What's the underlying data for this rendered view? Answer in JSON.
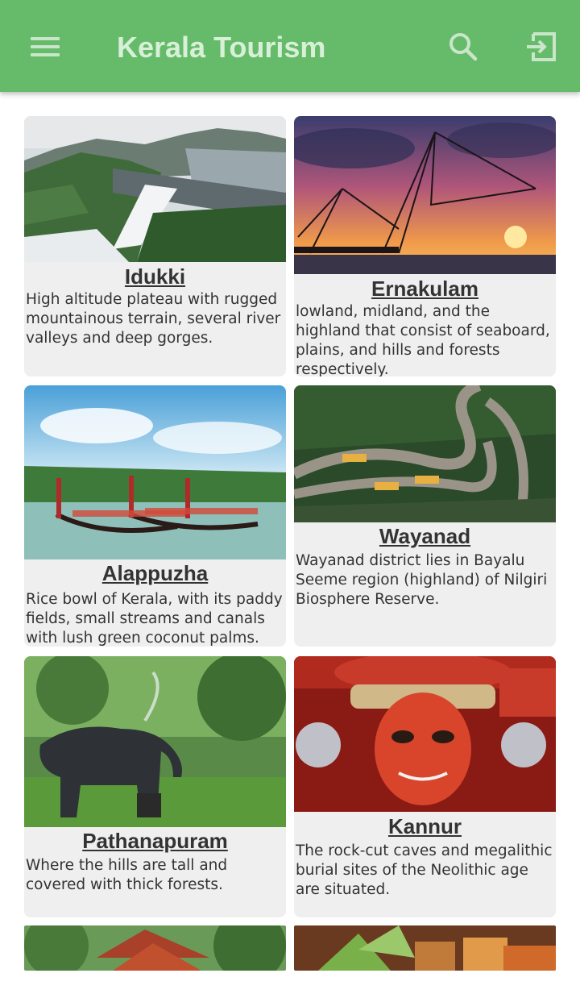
{
  "app_bar": {
    "title": "Kerala Tourism",
    "icons": [
      "menu-icon",
      "search-icon",
      "logout-icon"
    ],
    "color": "#66bb6a"
  },
  "places": [
    {
      "name": "Idukki",
      "description": "High altitude plateau with rugged mountainous terrain, several river valleys and deep gorges.",
      "image": "dam-reservoir-photo"
    },
    {
      "name": "Ernakulam",
      "description": "lowland, midland, and the highland that consist of seaboard, plains, and hills and forests respectively.",
      "image": "chinese-fishing-nets-sunset-photo"
    },
    {
      "name": "Alappuzha",
      "description": "Rice bowl of Kerala, with its paddy fields, small streams and canals with lush green coconut palms.",
      "image": "snake-boat-race-photo"
    },
    {
      "name": "Wayanad",
      "description": "Wayanad district lies in Bayalu Seeme region (highland) of Nilgiri Biosphere Reserve.",
      "image": "hairpin-bend-road-photo"
    },
    {
      "name": "Pathanapuram",
      "description": "Where the hills are tall and covered with thick forests.",
      "image": "elephant-photo"
    },
    {
      "name": "Kannur",
      "description": "The rock-cut caves and megalithic burial sites of the Neolithic age are situated.",
      "image": "theyyam-performer-photo"
    }
  ],
  "partial_cards": [
    "temple-roof-photo",
    "food-plate-photo"
  ]
}
